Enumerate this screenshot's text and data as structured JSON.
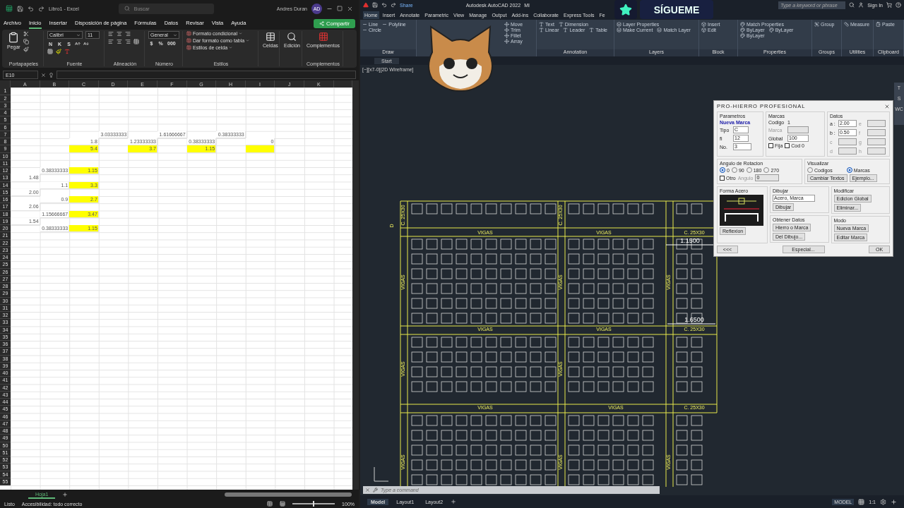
{
  "excel": {
    "title": "Libro1 - Excel",
    "search_placeholder": "Buscar",
    "user": "Andres Duran",
    "user_initials": "AD",
    "share_button": "Compartir",
    "menu_tabs": [
      {
        "label": "Archivo",
        "selected": false
      },
      {
        "label": "Inicio",
        "selected": true
      },
      {
        "label": "Insertar",
        "selected": false
      },
      {
        "label": "Disposición de página",
        "selected": false
      },
      {
        "label": "Fórmulas",
        "selected": false
      },
      {
        "label": "Datos",
        "selected": false
      },
      {
        "label": "Revisar",
        "selected": false
      },
      {
        "label": "Vista",
        "selected": false
      },
      {
        "label": "Ayuda",
        "selected": false
      }
    ],
    "ribbon": {
      "paste": "Pegar",
      "clipboard_label": "Portapapeles",
      "font": "Calibri",
      "font_size": "11",
      "font_buttons": [
        "N",
        "K",
        "S"
      ],
      "font_label": "Fuente",
      "align_label": "Alineación",
      "number_format": "General",
      "number_buttons": [
        "$",
        "%",
        "000"
      ],
      "number_label": "Número",
      "styles": [
        "Formato condicional",
        "Dar formato como tabla",
        "Estilos de celda"
      ],
      "styles_label": "Estilos",
      "cells": "Celdas",
      "editing": "Edición",
      "addins": "Complementos",
      "addins_label": "Complementos"
    },
    "name_box": "E10",
    "columns": [
      "A",
      "B",
      "C",
      "D",
      "E",
      "F",
      "G",
      "H",
      "I",
      "J",
      "K"
    ],
    "rows": [
      {
        "number": "1"
      },
      {
        "number": "2"
      },
      {
        "number": "3"
      },
      {
        "number": "4"
      },
      {
        "number": "5"
      },
      {
        "number": "6"
      },
      {
        "number": "7",
        "cells": [
          {},
          {},
          {},
          {
            "value": "3.03333333",
            "highlighted": false
          },
          {},
          {
            "value": "1.61666667",
            "highlighted": false
          },
          {},
          {
            "value": "0.38333333",
            "highlighted": false
          }
        ]
      },
      {
        "number": "8",
        "cells": [
          {},
          {},
          {
            "value": "1.8",
            "highlighted": false
          },
          {},
          {
            "value": "1.23333333",
            "highlighted": false
          },
          {},
          {
            "value": "0.38333333",
            "highlighted": false
          },
          {},
          {
            "value": "0",
            "highlighted": false
          }
        ]
      },
      {
        "number": "9",
        "cells": [
          {},
          {},
          {
            "value": "5.4",
            "highlighted": true
          },
          {},
          {
            "value": "3.7",
            "highlighted": true
          },
          {},
          {
            "value": "1.15",
            "highlighted": true
          },
          {},
          {
            "highlighted": true
          }
        ]
      },
      {
        "number": "10"
      },
      {
        "number": "11"
      },
      {
        "number": "12",
        "cells": [
          {},
          {
            "value": "0.38333333",
            "highlighted": false
          },
          {
            "value": "1.15",
            "highlighted": true
          }
        ]
      },
      {
        "number": "13",
        "cells": [
          {
            "value": "1.48",
            "highlighted": false
          }
        ]
      },
      {
        "number": "14",
        "cells": [
          {},
          {
            "value": "1.1",
            "highlighted": false
          },
          {
            "value": "3.3",
            "highlighted": true
          }
        ]
      },
      {
        "number": "15",
        "cells": [
          {
            "value": "2.00",
            "highlighted": false
          }
        ]
      },
      {
        "number": "16",
        "cells": [
          {},
          {
            "value": "0.9",
            "highlighted": false
          },
          {
            "value": "2.7",
            "highlighted": true
          }
        ]
      },
      {
        "number": "17",
        "cells": [
          {
            "value": "2.06",
            "highlighted": false
          }
        ]
      },
      {
        "number": "18",
        "cells": [
          {},
          {
            "value": "1.15666667",
            "highlighted": false
          },
          {
            "value": "3.47",
            "highlighted": true
          }
        ]
      },
      {
        "number": "19",
        "cells": [
          {
            "value": "1.54",
            "highlighted": false
          }
        ]
      },
      {
        "number": "20",
        "cells": [
          {},
          {
            "value": "0.38333333",
            "highlighted": false
          },
          {
            "value": "1.15",
            "highlighted": true
          }
        ]
      },
      {
        "number": "21"
      },
      {
        "number": "22"
      },
      {
        "number": "23"
      },
      {
        "number": "24"
      },
      {
        "number": "25"
      },
      {
        "number": "26"
      },
      {
        "number": "27"
      },
      {
        "number": "28"
      },
      {
        "number": "29"
      },
      {
        "number": "30"
      },
      {
        "number": "31"
      },
      {
        "number": "32"
      },
      {
        "number": "33"
      },
      {
        "number": "34"
      },
      {
        "number": "35"
      },
      {
        "number": "36"
      },
      {
        "number": "37"
      },
      {
        "number": "38"
      },
      {
        "number": "39"
      },
      {
        "number": "40"
      },
      {
        "number": "41"
      },
      {
        "number": "42"
      },
      {
        "number": "43"
      },
      {
        "number": "44"
      },
      {
        "number": "45"
      },
      {
        "number": "46"
      },
      {
        "number": "47"
      },
      {
        "number": "48"
      },
      {
        "number": "49"
      },
      {
        "number": "50"
      },
      {
        "number": "51"
      },
      {
        "number": "52"
      },
      {
        "number": "53"
      },
      {
        "number": "54"
      },
      {
        "number": "55"
      }
    ],
    "sheet_tabs": [
      {
        "label": "Hoja1",
        "selected": true
      }
    ],
    "status": "Listo",
    "accessibility": "Accesibilidad: todo correcto",
    "zoom_slider": {
      "level": 0.5
    },
    "zoom": "100%"
  },
  "autocad": {
    "title": "Autodesk AutoCAD 2022",
    "document": "MI",
    "share": "Share",
    "search_placeholder": "Type a keyword or phrase",
    "sign_in": "Sign In",
    "tabs": [
      {
        "label": "Home",
        "selected": true
      },
      {
        "label": "Insert",
        "selected": false
      },
      {
        "label": "Annotate",
        "selected": false
      },
      {
        "label": "Parametric",
        "selected": false
      },
      {
        "label": "View",
        "selected": false
      },
      {
        "label": "Manage",
        "selected": false
      },
      {
        "label": "Output",
        "selected": false
      },
      {
        "label": "Add-ins",
        "selected": false
      },
      {
        "label": "Collaborate",
        "selected": false
      },
      {
        "label": "Express Tools",
        "selected": false
      },
      {
        "label": "Fe",
        "selected": false
      }
    ],
    "panels": [
      {
        "label": "Draw",
        "tools": [
          "Line",
          "Polyline",
          "Circle"
        ]
      },
      {
        "tools": [
          "Move",
          "Trim",
          "Fillet",
          "Array"
        ]
      },
      {
        "label": "Annotation",
        "tools": [
          "Text",
          "Dimension",
          "Linear",
          "Leader",
          "Table"
        ]
      },
      {
        "label": "Layers",
        "tools": [
          "Layer Properties",
          "Make Current",
          "Match Layer"
        ]
      },
      {
        "label": "Block",
        "tools": [
          "Insert",
          "Edit"
        ]
      },
      {
        "label": "Properties",
        "tools": [
          "Match Properties",
          "ByLayer",
          "ByLayer",
          "ByLayer"
        ]
      },
      {
        "label": "Groups",
        "tools": [
          "Group"
        ]
      },
      {
        "label": "Utilities",
        "tools": [
          "Measure"
        ]
      },
      {
        "label": "Clipboard",
        "tools": [
          "Paste"
        ]
      }
    ],
    "file_tabs": [
      {
        "label": "Start",
        "selected": false
      }
    ],
    "viewport_label": "[−][x7-0][2D Wireframe]",
    "viewcube_labels": [
      "T",
      "S",
      "WC"
    ],
    "drawing_labels": [
      {
        "text": "C. 25X30",
        "kind": "column"
      },
      {
        "text": "C. 25X30",
        "kind": "column"
      },
      {
        "text": "D",
        "kind": "column"
      },
      {
        "text": "VIGAS",
        "kind": "beam"
      },
      {
        "text": "VIGAS",
        "kind": "beam"
      },
      {
        "text": "C. 25X30",
        "kind": "column"
      },
      {
        "text": "1.1500",
        "kind": "dimension"
      },
      {
        "text": "VIGAS",
        "kind": "beam"
      },
      {
        "text": "VIGAS",
        "kind": "beam"
      },
      {
        "text": "VIGAS",
        "kind": "beam"
      },
      {
        "text": "1.6500",
        "kind": "dimension"
      },
      {
        "text": "VIGAS",
        "kind": "beam"
      },
      {
        "text": "VIGAS",
        "kind": "beam"
      },
      {
        "text": "C. 25X30",
        "kind": "column"
      },
      {
        "text": "VIGAS",
        "kind": "beam"
      },
      {
        "text": "VIGAS",
        "kind": "beam"
      },
      {
        "text": "VIGAS",
        "kind": "beam"
      },
      {
        "text": "VIGAS",
        "kind": "beam"
      },
      {
        "text": "C. 25X30",
        "kind": "column"
      },
      {
        "text": "VIGAS",
        "kind": "beam"
      },
      {
        "text": "VIGAS",
        "kind": "beam"
      },
      {
        "text": "VIGAS",
        "kind": "beam"
      }
    ],
    "command_placeholder": "Type a command",
    "layout_tabs": [
      {
        "label": "Model",
        "selected": true
      },
      {
        "label": "Layout1",
        "selected": false
      },
      {
        "label": "Layout2",
        "selected": false
      }
    ],
    "status_model": "MODEL",
    "status_scale": "1:1",
    "overlay_text": "SÍGUEME",
    "dialog": {
      "title": "PRO-HIERRO  PROFESIONAL",
      "parametros": {
        "label": "Parametros",
        "mark": "Nueva Marca",
        "tipo_label": "Tipo",
        "tipo": "C",
        "fi_label": "fi",
        "fi": "12",
        "no_label": "No.",
        "no": "3"
      },
      "marcas": {
        "label": "Marcas",
        "codigo_label": "Codigo",
        "codigo": "1",
        "marca_label": "Marca",
        "global_label": "Global",
        "global": "100",
        "checks": [
          {
            "label": "Fija",
            "checked": false
          },
          {
            "label": "Cod 0",
            "checked": false
          }
        ]
      },
      "datos": {
        "label": "Datos",
        "fields": [
          {
            "label": "a :",
            "value": "2.00",
            "disabled": false
          },
          {
            "label": "e",
            "disabled": true
          },
          {
            "label": "b :",
            "value": "0.50",
            "disabled": false
          },
          {
            "label": "f",
            "disabled": true
          },
          {
            "label": "c",
            "disabled": true
          },
          {
            "label": "g",
            "disabled": true
          },
          {
            "label": "d",
            "disabled": true
          },
          {
            "label": "h",
            "disabled": true
          }
        ]
      },
      "rotacion": {
        "label": "Angulo de Rotacion",
        "options": [
          {
            "label": "0",
            "selected": true
          },
          {
            "label": "90",
            "selected": false
          },
          {
            "label": "180",
            "selected": false
          },
          {
            "label": "270",
            "selected": false
          }
        ],
        "other": {
          "label": "Otro",
          "checked": false
        },
        "angle_label": "Angulo",
        "angle": "0"
      },
      "visualizar": {
        "label": "Visualizar",
        "options": [
          {
            "label": "Codigos",
            "selected": false
          },
          {
            "label": "Marcas",
            "selected": true
          }
        ],
        "buttons": [
          "Cambiar Textos",
          "Ejemplo..."
        ]
      },
      "forma": {
        "label": "Forma Acero",
        "button": "Reflexion"
      },
      "dibujar": {
        "label": "Dibujar",
        "select": "Acero, Marca",
        "button": "Dibujar"
      },
      "obtener": {
        "label": "Obtener Datos",
        "buttons": [
          "Hierro o Marca",
          "Del Dibujo..."
        ]
      },
      "modificar": {
        "label": "Modificar",
        "buttons": [
          "Edicion Global",
          "Eliminar..."
        ]
      },
      "modo": {
        "label": "Modo",
        "buttons": [
          "Nueva Marca",
          "Editar Marca"
        ]
      },
      "footer": [
        "<<<",
        "Especial...",
        "OK"
      ]
    }
  }
}
